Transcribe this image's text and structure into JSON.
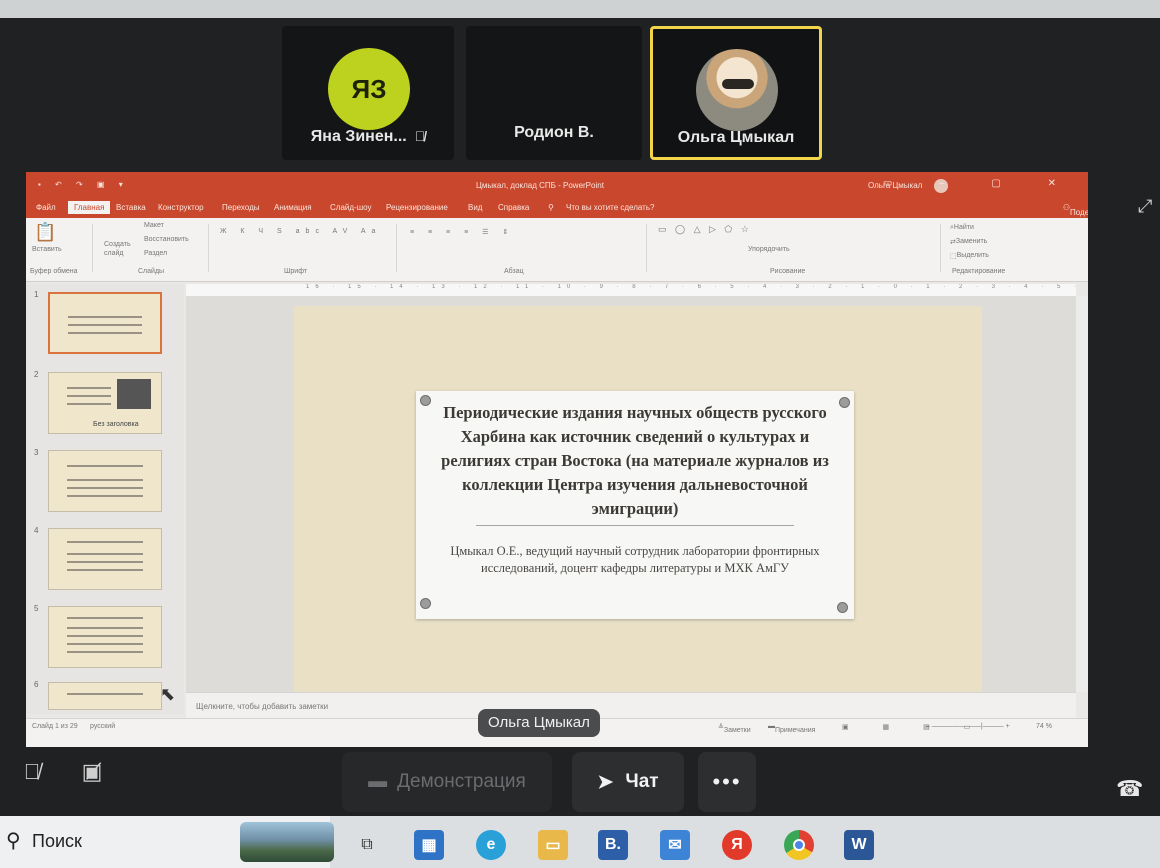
{
  "participants": [
    {
      "initials": "ЯЗ",
      "name": "Яна Зинен...",
      "muted": true
    },
    {
      "name": "Родион В."
    },
    {
      "name": "Ольга Цмыкал",
      "active_speaker": true
    }
  ],
  "powerpoint": {
    "title_bar": "Цмыкал, доклад СПБ - PowerPoint",
    "user": "Ольга Цмыкал",
    "tabs": [
      "Файл",
      "Главная",
      "Вставка",
      "Конструктор",
      "Переходы",
      "Анимация",
      "Слайд-шоу",
      "Рецензирование",
      "Вид",
      "Справка",
      "Что вы хотите сделать?"
    ],
    "share_label": "Поделиться",
    "ribbon": {
      "paste": "Вставить",
      "create_slide": "Создать слайд",
      "layout": "Макет",
      "reset": "Восстановить",
      "section": "Раздел",
      "clipboard": "Буфер обмена",
      "slides": "Слайды",
      "font": "Шрифт",
      "paragraph": "Абзац",
      "arrange": "Упорядочить",
      "drawing": "Рисование",
      "find": "Найти",
      "replace": "Заменить",
      "select": "Выделить",
      "editing": "Редактирование"
    },
    "ruler": "16 · 15 · 14 · 13 · 12 · 11 · 10 · 9 · 8 · 7 · 6 · 5 · 4 · 3 · 2 · 1 · 0 · 1 · 2 · 3 · 4 · 5 · 6 · 7 · 8 · 9 · 10 · 11 · 12 · 13 · 14 · 15 · 16",
    "thumbnails": [
      "1",
      "2",
      "3",
      "4",
      "5",
      "6"
    ],
    "thumb_caption": "Без заголовка",
    "slide": {
      "title": "Периодические издания научных обществ русского Харбина как источник сведений о культурах и религиях стран Востока (на материале журналов из коллекции Центра изучения дальневосточной эмиграции)",
      "subtitle": "Цмыкал О.Е., ведущий научный сотрудник лаборатории фронтирных исследований, доцент кафедры литературы и МХК АмГУ"
    },
    "notes_placeholder": "Щелкните, чтобы добавить заметки",
    "status": {
      "slide_count": "Слайд 1 из 29",
      "language": "русский",
      "notes": "Заметки",
      "comments": "Примечания",
      "zoom": "74 %"
    }
  },
  "speaker_label": "Ольга Цмыкал",
  "controls": {
    "demo": "Демонстрация",
    "chat": "Чат",
    "more": "•••"
  },
  "taskbar": {
    "search": "Поиск",
    "apps": [
      "task-view",
      "store",
      "edge",
      "explorer",
      "vk",
      "mail",
      "yandex",
      "chrome",
      "word"
    ]
  },
  "colors": {
    "accent_powerpoint": "#c9472c",
    "speaker_border": "#f2d54a",
    "avatar_yz": "#bcd21e"
  }
}
